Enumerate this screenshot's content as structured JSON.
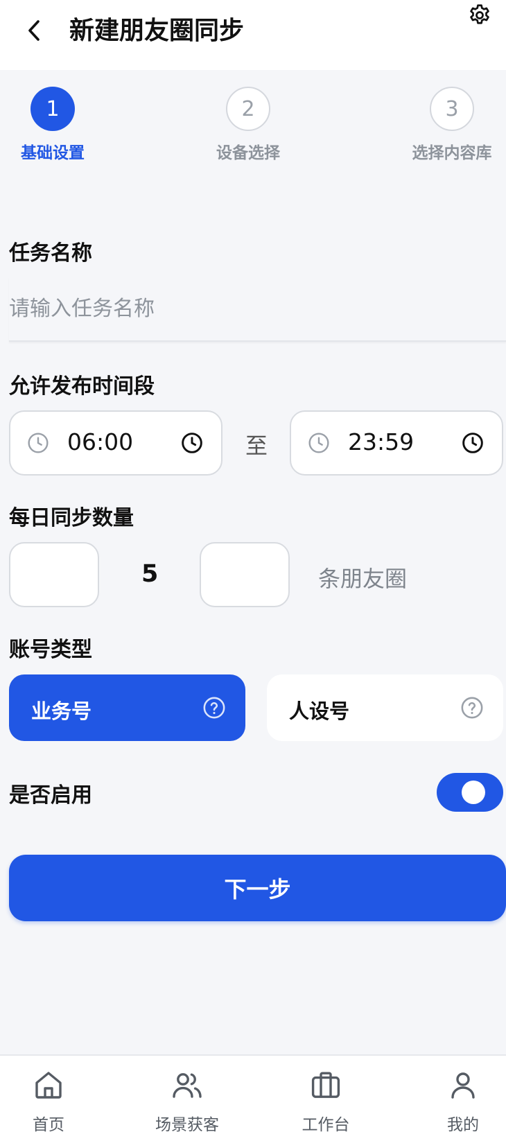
{
  "header": {
    "title": "新建朋友圈同步"
  },
  "stepper": {
    "steps": [
      {
        "number": "1",
        "label": "基础设置"
      },
      {
        "number": "2",
        "label": "设备选择"
      },
      {
        "number": "3",
        "label": "选择内容库"
      }
    ],
    "current_step": 1
  },
  "form": {
    "task_name": {
      "label": "任务名称",
      "placeholder": "请输入任务名称",
      "value": ""
    },
    "time_range": {
      "label": "允许发布时间段",
      "start": "06:00",
      "separator": "至",
      "end": "23:59"
    },
    "daily_count": {
      "label": "每日同步数量",
      "value": "5",
      "unit": "条朋友圈"
    },
    "account_type": {
      "label": "账号类型",
      "options": [
        {
          "label": "业务号",
          "selected": true
        },
        {
          "label": "人设号",
          "selected": false
        }
      ]
    },
    "enabled": {
      "label": "是否启用",
      "value": true
    }
  },
  "actions": {
    "next_label": "下一步"
  },
  "bottom_nav": {
    "items": [
      {
        "label": "首页",
        "icon": "home-icon"
      },
      {
        "label": "场景获客",
        "icon": "users-icon"
      },
      {
        "label": "工作台",
        "icon": "briefcase-icon"
      },
      {
        "label": "我的",
        "icon": "user-icon"
      }
    ]
  },
  "colors": {
    "accent": "#2157e4",
    "background": "#f5f6f9"
  }
}
